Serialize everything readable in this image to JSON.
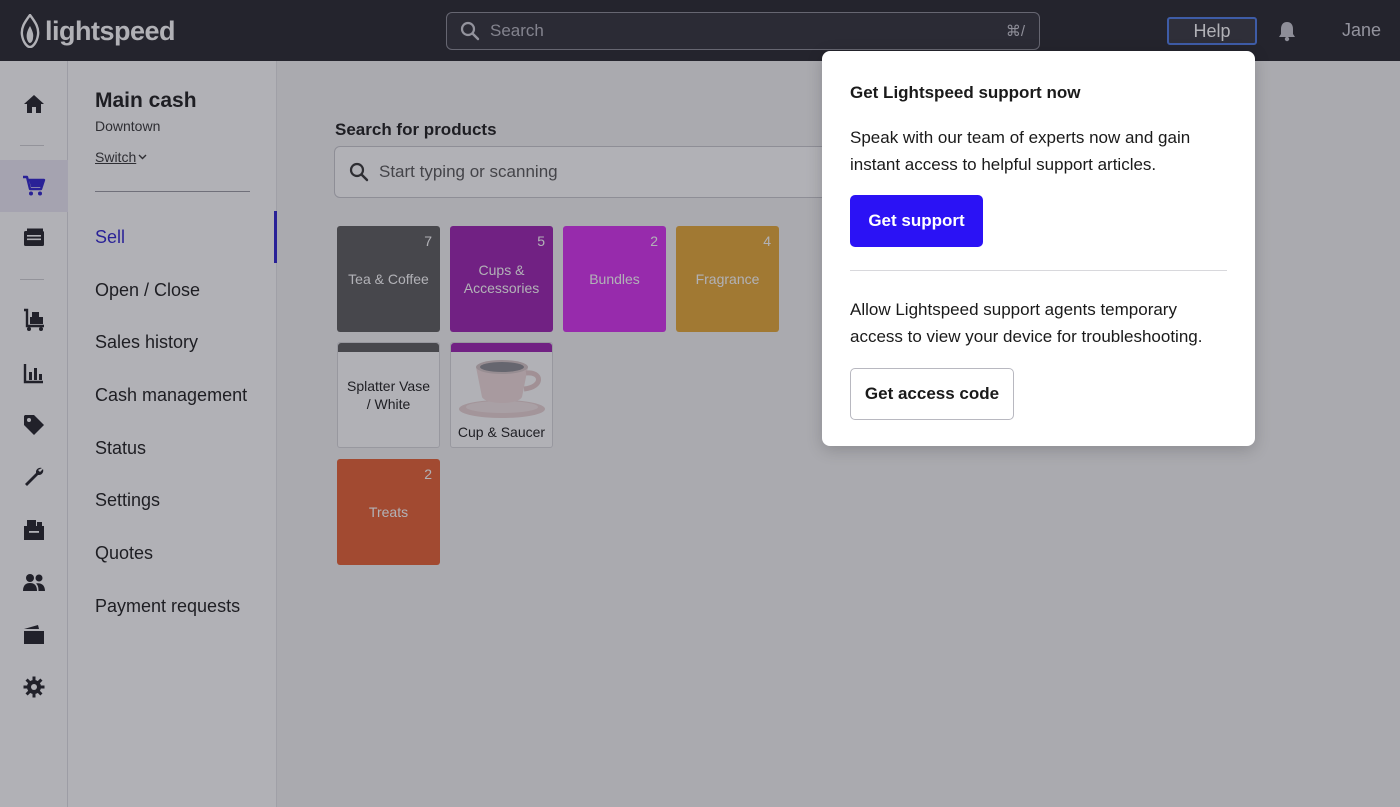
{
  "topbar": {
    "logo_text": "lightspeed",
    "search_placeholder": "Search",
    "search_shortcut": "⌘/",
    "help_label": "Help",
    "user_name": "Jane"
  },
  "rail": {
    "items": [
      {
        "icon": "home-icon"
      },
      {
        "icon": "cart-icon",
        "active": true
      },
      {
        "icon": "register-icon"
      },
      {
        "icon": "inventory-cart-icon"
      },
      {
        "icon": "reports-chart-icon"
      },
      {
        "icon": "tag-icon"
      },
      {
        "icon": "wrench-icon"
      },
      {
        "icon": "warehouse-icon"
      },
      {
        "icon": "customers-icon"
      },
      {
        "icon": "folder-icon"
      },
      {
        "icon": "gear-icon"
      }
    ]
  },
  "sidebar": {
    "register_title": "Main cash",
    "register_location": "Downtown",
    "switch_label": "Switch",
    "nav": [
      {
        "label": "Sell",
        "active": true
      },
      {
        "label": "Open / Close"
      },
      {
        "label": "Sales history"
      },
      {
        "label": "Cash management"
      },
      {
        "label": "Status"
      },
      {
        "label": "Settings"
      },
      {
        "label": "Quotes"
      },
      {
        "label": "Payment requests"
      }
    ]
  },
  "main": {
    "search_label": "Search for products",
    "search_placeholder": "Start typing or scanning",
    "tiles": [
      {
        "label": "Tea & Coffee",
        "count": "7",
        "color": "#5a5a5a"
      },
      {
        "label": "Cups & Accessories",
        "count": "5",
        "color": "#9c1fb0"
      },
      {
        "label": "Bundles",
        "count": "2",
        "color": "#d62ef0"
      },
      {
        "label": "Fragrance",
        "count": "4",
        "color": "#e6a832"
      },
      {
        "label": "Splatter Vase / White",
        "count": "",
        "color": "#5a5a5a"
      },
      {
        "label": "Cup & Saucer",
        "count": "",
        "color": "#9c1fb0"
      },
      {
        "label": "Treats",
        "count": "2",
        "color": "#e85f30"
      }
    ]
  },
  "popover": {
    "title": "Get Lightspeed support now",
    "body1": "Speak with our team of experts now and gain instant access to helpful support articles.",
    "button1": "Get support",
    "body2": "Allow Lightspeed support agents temporary access to view your device for troubleshooting.",
    "button2": "Get access code"
  },
  "colors": {
    "accent": "#2b12f5",
    "topbar_bg": "#23232a",
    "active_nav": "#2b1ecf"
  }
}
